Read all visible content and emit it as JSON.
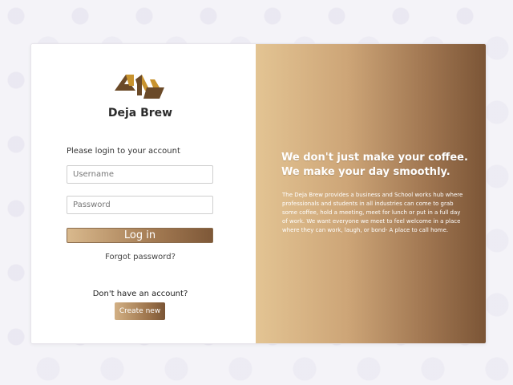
{
  "brand": {
    "name": "Deja Brew",
    "logo_icon": "deja-brew-logo-icon"
  },
  "login": {
    "prompt": "Please login to your account",
    "username_placeholder": "Username",
    "password_placeholder": "Password",
    "login_label": "Log in",
    "forgot_label": "Forgot password?"
  },
  "signup": {
    "question": "Don't have an account?",
    "create_label": "Create new"
  },
  "promo": {
    "headline_line1": "We don't just make your coffee.",
    "headline_line2": "We make your day smoothly.",
    "body": "The Deja Brew provides a business and School works hub where professionals and students in all industries can come to grab some coffee, hold a meeting, meet for lunch or put in a full day of work. We want everyone we meet to feel welcome in a place where they can work, laugh, or bond- A place to call home."
  },
  "colors": {
    "accent_light": "#e3c493",
    "accent_dark": "#7b5536",
    "logo_gold": "#c8932e",
    "logo_brown": "#6b4a28"
  }
}
